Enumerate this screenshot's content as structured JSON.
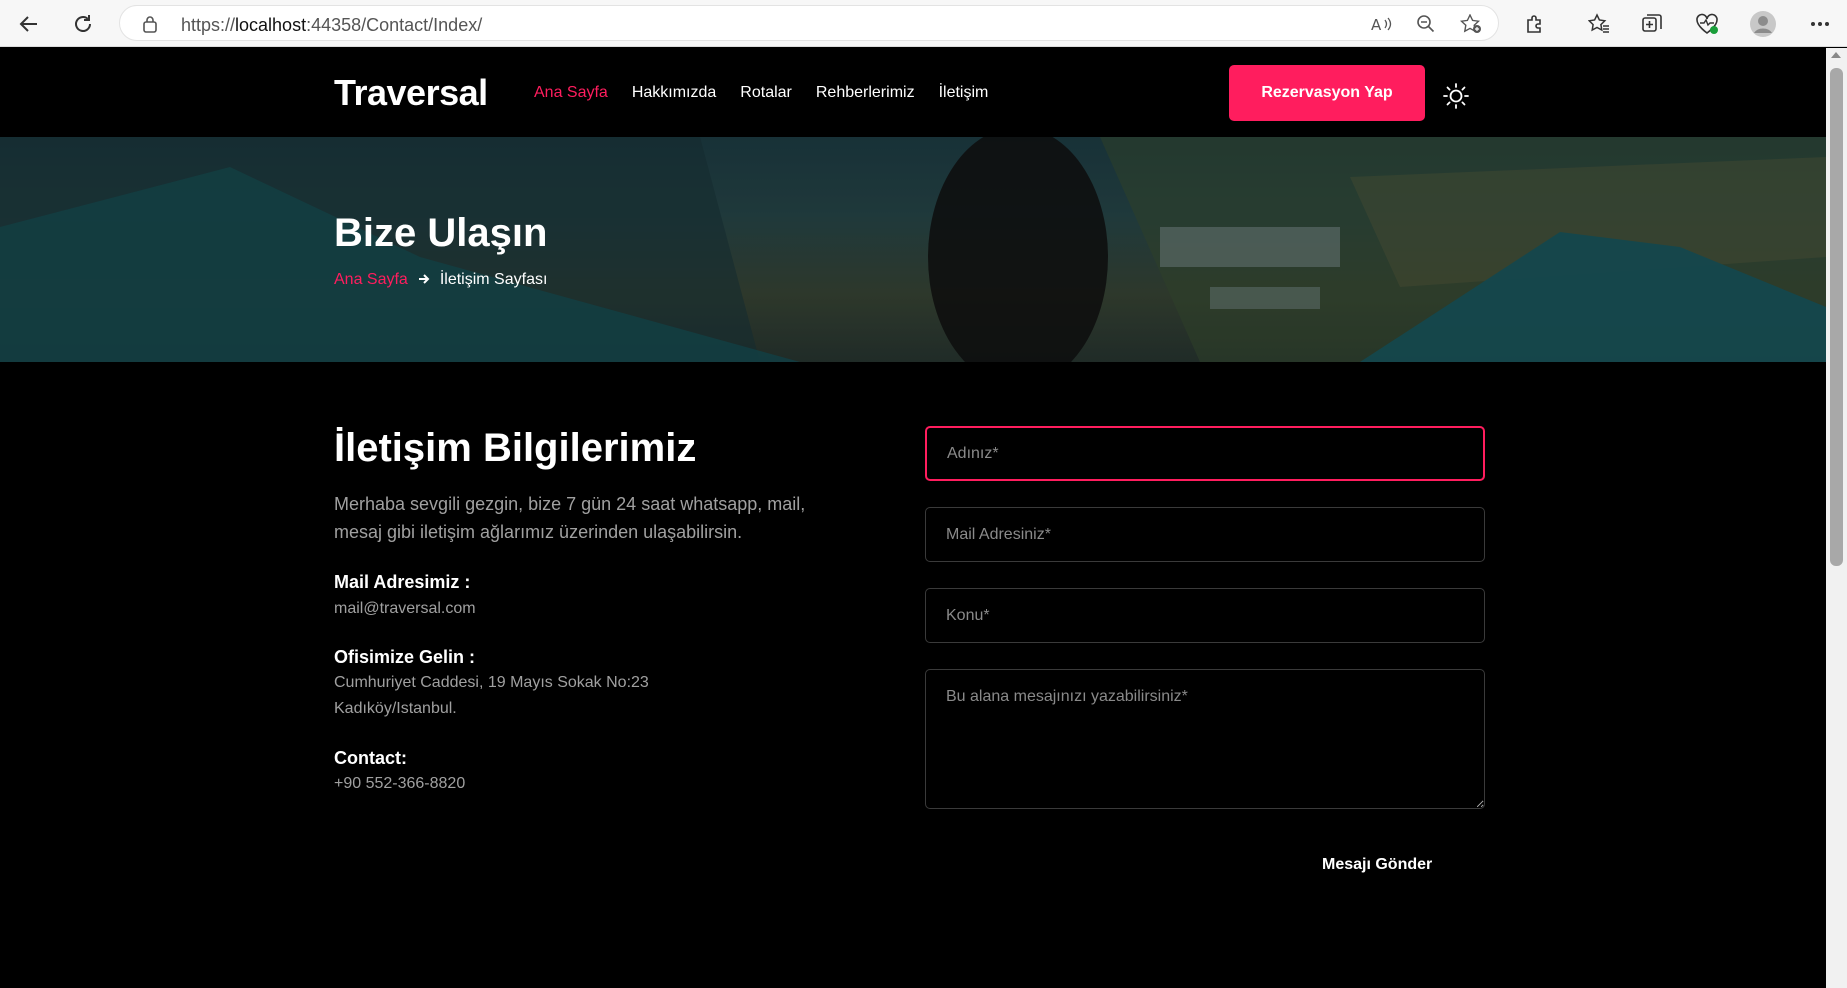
{
  "browser": {
    "url_prefix": "https://",
    "url_host": "localhost",
    "url_rest": ":44358/Contact/Index/"
  },
  "header": {
    "logo": "Traversal",
    "menu": [
      "Ana Sayfa",
      "Hakkımızda",
      "Rotalar",
      "Rehberlerimiz",
      "İletişim"
    ],
    "cta": "Rezervasyon Yap"
  },
  "hero": {
    "title": "Bize Ulaşın",
    "breadcrumb_home": "Ana Sayfa",
    "breadcrumb_current": "İletişim Sayfası"
  },
  "contact_info": {
    "title": "İletişim Bilgilerimiz",
    "description": "Merhaba sevgili gezgin, bize 7 gün 24 saat whatsapp, mail, mesaj gibi iletişim ağlarımız üzerinden ulaşabilirsin.",
    "mail_label": "Mail Adresimiz :",
    "mail_value": "mail@traversal.com",
    "office_label": "Ofisimize Gelin :",
    "office_line1": "Cumhuriyet Caddesi, 19 Mayıs Sokak No:23",
    "office_line2": "Kadıköy/Istanbul.",
    "contact_label": "Contact:",
    "contact_value": "+90 552-366-8820"
  },
  "form": {
    "name_placeholder": "Adınız*",
    "mail_placeholder": "Mail Adresiniz*",
    "subject_placeholder": "Konu*",
    "message_placeholder": "Bu alana mesajınızı yazabilirsiniz*",
    "send_label": "Mesajı Gönder"
  },
  "colors": {
    "accent": "#ff1d5e",
    "background": "#000000",
    "muted_text": "#a0a0a0"
  }
}
